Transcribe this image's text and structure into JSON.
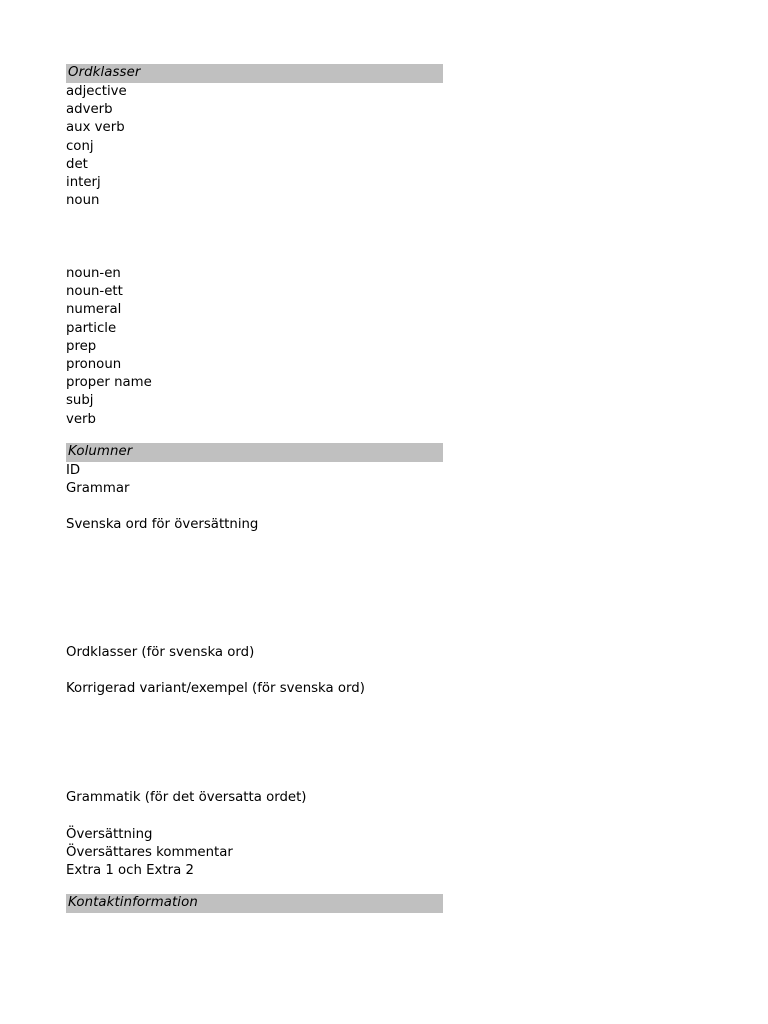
{
  "document": {
    "background_color": "#ffffff",
    "text_color": "#000000",
    "section_bar_color": "#c0c0c0"
  },
  "sections": [
    {
      "id": "ordklasser",
      "heading": "Ordklasser",
      "group_a": [
        "adjective",
        "adverb",
        "aux verb",
        "conj",
        "det",
        "interj",
        "noun"
      ],
      "group_b": [
        "noun-en",
        "noun-ett",
        "numeral",
        "particle",
        "prep",
        "pronoun",
        "proper name",
        "subj",
        "verb"
      ]
    },
    {
      "id": "kolumner",
      "heading": "Kolumner",
      "entries": [
        "ID",
        "Grammar",
        "Svenska ord för översättning",
        "Ordklasser (för svenska ord)",
        "Korrigerad variant/exempel (för svenska ord)",
        "Grammatik (för det översatta ordet)",
        "Översättning",
        "Översättares kommentar",
        "Extra 1 och Extra 2"
      ]
    },
    {
      "id": "kontaktinformation",
      "heading": "Kontaktinformation"
    }
  ]
}
